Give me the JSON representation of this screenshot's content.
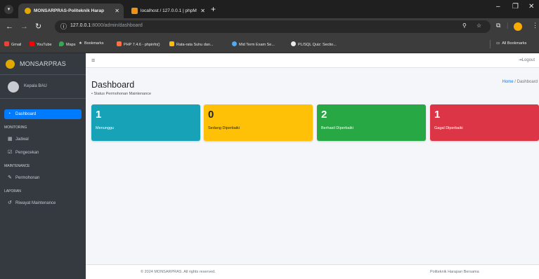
{
  "browser": {
    "tabs": [
      {
        "title": "MONSARPRAS-Politeknik Harap",
        "active": true
      },
      {
        "title": "localhost / 127.0.0.1 | phpMyAd",
        "active": false
      }
    ],
    "address": {
      "host": "127.0.0.1",
      "path": ":8000/admin/dashboard"
    },
    "bookmarks": [
      {
        "label": "Gmail",
        "icon": "gmail-icon",
        "color": "#ea4335"
      },
      {
        "label": "YouTube",
        "icon": "youtube-icon",
        "color": "#ff0000"
      },
      {
        "label": "Maps",
        "icon": "maps-icon",
        "color": "#34a853"
      },
      {
        "label": "Bookmarks",
        "icon": "star-icon",
        "color": "#e8eaed"
      },
      {
        "label": "PHP 7.4.6 - phpinfo()",
        "icon": "php-icon",
        "color": "#ff7043"
      },
      {
        "label": "Rata-rata Suhu dan...",
        "icon": "sheet-icon",
        "color": "#fbbc04"
      },
      {
        "label": "Mid Term Exam Se...",
        "icon": "globe-icon",
        "color": "#4dabf7"
      },
      {
        "label": "PL/SQL Quiz: Sectio...",
        "icon": "github-icon",
        "color": "#e8eaed"
      }
    ],
    "all_bookmarks": "All Bookmarks"
  },
  "brand": {
    "name": "MONSARPRAS",
    "color": "#e0a800"
  },
  "user": {
    "name": "Kepala BAU"
  },
  "sidebar": {
    "top_header": "",
    "dashboard": "Dashboard",
    "monitoring_header": "MONITORING",
    "jadwal": "Jadwal",
    "pengecekan": "Pengecekan",
    "maintenance_header": "MAINTENANCE",
    "permohonan": "Permohonan",
    "laporan_header": "LAPORAN",
    "riwayat": "Riwayat Maintenance",
    "bottom_header": ""
  },
  "topnav": {
    "logout": "Logout"
  },
  "page": {
    "title": "Dashboard",
    "subtitle": "Status Permohonan Maintenance",
    "breadcrumb_home": "Home",
    "breadcrumb_sep": "/",
    "breadcrumb_current": "Dashboard"
  },
  "cards": [
    {
      "count": "1",
      "label": "Menunggu",
      "bg": "#17a2b8",
      "fg": "#ffffff"
    },
    {
      "count": "0",
      "label": "Sedang Diperbaiki",
      "bg": "#ffc107",
      "fg": "#212529"
    },
    {
      "count": "2",
      "label": "Berhasil Diperbaiki",
      "bg": "#28a745",
      "fg": "#ffffff"
    },
    {
      "count": "1",
      "label": "Gagal Diperbaiki",
      "bg": "#dc3545",
      "fg": "#ffffff"
    }
  ],
  "footer": {
    "copyright": "© 2024 MONSARPRAS. All rights reserved.",
    "org": "Politeknik Harapan Bersama"
  },
  "colors": {
    "sidebar": "#343a40",
    "active": "#007bff",
    "content": "#f4f6f9"
  }
}
